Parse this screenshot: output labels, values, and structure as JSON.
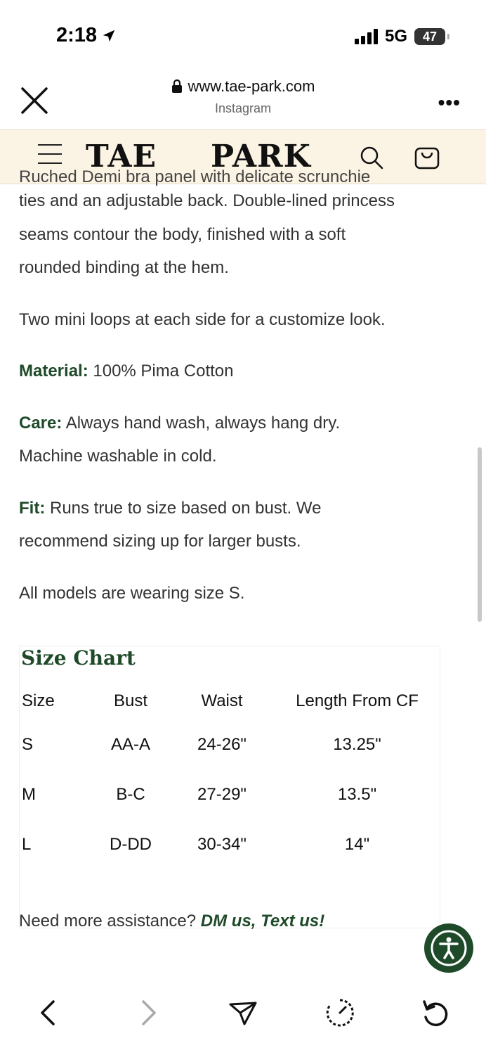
{
  "status": {
    "time": "2:18",
    "network": "5G",
    "battery": "47"
  },
  "browser": {
    "url": "www.tae-park.com",
    "source": "Instagram"
  },
  "header": {
    "brand_left": "TAE",
    "brand_right": "PARK"
  },
  "description": {
    "cut_line": "Ruched Demi bra panel with delicate scrunchie",
    "para1_line1": "ties and an adjustable back. Double-lined princess",
    "para1_line2": "seams contour the body, finished with a soft",
    "para1_line3": "rounded binding at the hem.",
    "para2": "Two mini loops at each side for a customize look.",
    "material_label": "Material:",
    "material_value": " 100% Pima Cotton",
    "care_label": "Care:",
    "care_value_line1": " Always hand wash, always hang dry.",
    "care_value_line2": "Machine washable in cold.",
    "fit_label": "Fit:",
    "fit_value_line1": " Runs true to size based on bust. We",
    "fit_value_line2": "recommend sizing up for larger busts.",
    "models_note": "All models are wearing size S."
  },
  "size_chart": {
    "title": "Size Chart",
    "headers": [
      "Size",
      "Bust",
      "Waist",
      "Length From CF"
    ],
    "rows": [
      [
        "S",
        "AA-A",
        "24-26\"",
        "13.25\""
      ],
      [
        "M",
        "B-C",
        "27-29\"",
        "13.5\""
      ],
      [
        "L",
        "D-DD",
        "30-34\"",
        "14\""
      ]
    ]
  },
  "assistance": {
    "prompt": "Need more assistance? ",
    "link": "DM us, Text us!"
  },
  "icons": {
    "close": "close-icon",
    "lock": "lock-icon",
    "more": "more-icon",
    "menu": "hamburger-icon",
    "search": "search-icon",
    "cart": "cart-icon",
    "accessibility": "accessibility-icon",
    "back": "chevron-left-icon",
    "forward": "chevron-right-icon",
    "share": "send-icon",
    "history": "history-icon",
    "reload": "reload-icon"
  },
  "colors": {
    "accent": "#1f4a2a",
    "header_bg": "#fbf3e3"
  }
}
